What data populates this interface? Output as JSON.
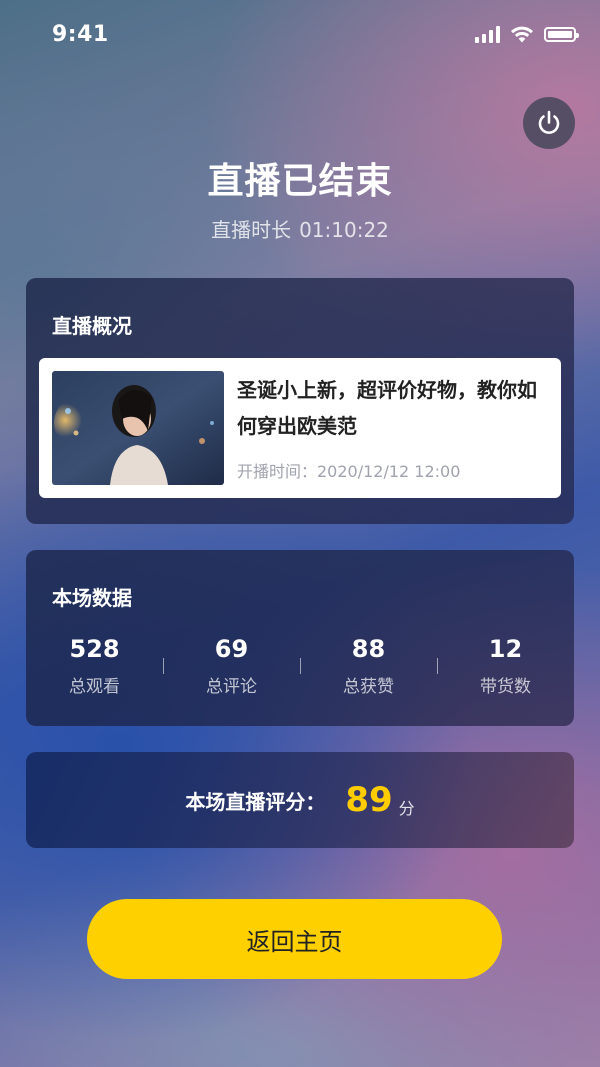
{
  "status_bar": {
    "time": "9:41"
  },
  "header": {
    "power_icon": "power-icon",
    "title": "直播已结束",
    "duration_label": "直播时长",
    "duration_value": "01:10:22"
  },
  "overview": {
    "title": "直播概况",
    "item": {
      "title": "圣诞小上新，超评价好物，教你如何穿出欧美范",
      "start_time": "开播时间：2020/12/12 12:00"
    }
  },
  "stats_section": {
    "title": "本场数据",
    "items": [
      {
        "value": "528",
        "label": "总观看"
      },
      {
        "value": "69",
        "label": "总评论"
      },
      {
        "value": "88",
        "label": "总获赞"
      },
      {
        "value": "12",
        "label": "带货数"
      }
    ]
  },
  "score": {
    "label": "本场直播评分：",
    "value": "89",
    "unit": "分"
  },
  "actions": {
    "back_home": "返回主页"
  },
  "colors": {
    "accent": "#ffd000",
    "score": "#ffcc00"
  }
}
